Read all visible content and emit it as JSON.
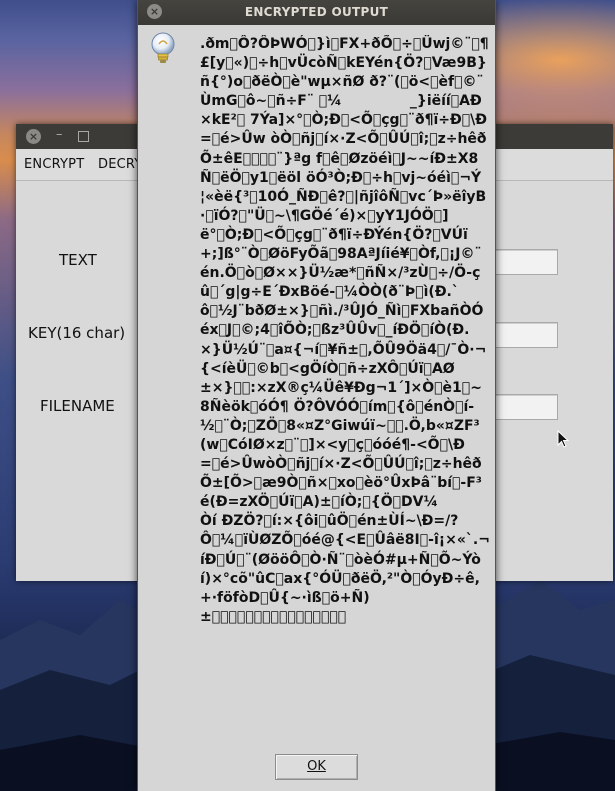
{
  "background_window": {
    "menu": [
      "ENCRYPT",
      "DECRY"
    ],
    "labels": {
      "text": "TEXT",
      "key": "KEY(16 char)",
      "filename": "FILENAME"
    }
  },
  "dialog": {
    "title": "ENCRYPTED OUTPUT",
    "icon": "info-lightbulb-icon",
    "message": ".ðm\u0000Ô?ÔÞWÓ\u0000}ì\u0000FX+ðÕ\u0000÷\u0000Üwj©¨\u0000¶£[y\u0000«)\u0000÷h\u0000vÜcòÑ\u0000kEYén{Ö?\u0000Væ9B}ñ{°)o\u0000ðëÒ\u0000è\"wµ×ñØ ð?¨(\u0000ö<\u0000èf\u0000©¨ÙmG\u0000ô~\u0000ñ÷F¨ \u0000¼              _}iëíí\u0000AÐ×kE²\u0000 7Ýa]×°\u0000Ò;Ð\u0000<Õ\u0000çg\u0000¨ð¶ï÷Ð\u0000\\Ð=\u0000é>Ûw òÒ\u0000ñj\u0000í×·Z<Õ\u0000ÛÚ\u0000î;\u0000z÷hêðÕ±êE\u0000\u0000\u0000\u0000¨}ªg f\u0000ê\u0000Øzöéì\u0000J~~íÐ±X8Ñ\u0000ëÖ\u0000y1\u0000ëöl öÓ³Ò;Ð\u0000÷h\u0000vj~óéì\u0000¬Ý¦«èë{³\u000010Ó_ÑÐ\u0000ê?\u0000|ñjîôÑ\u0000vc´Þ»ëîyB·\u0000ïÓ?\u0000\"Ü\u0000~\\¶GÖé´é)×\u0000yY1JÓÖ\u0000]ë°\u0000Ò;Ð\u0000<Õ\u0000çg\u0000¨ð¶ï÷ÐÝén{Ö?\u0000VÚï+;]ß°¨Ò\u0000ØöFyÕã\u000098AªJíié¥\u0000Òf,\u0000¡J©¨én.Ö\u0000ò\u0000Ø××}Ü½æ*\u0000ñÑ×/³zÙ\u0000÷/Ö-çû\u0000´g|g÷E´ÐxBöé-\u0000¼ÒÒ(ð¨Þ\u0000ì(Ð.`ô\u0000½J¨bðØ±×}\u0000ñì./³ÛJÓ_Ñì\u0000FXbañÒÓéx\u0000J\u0000©;4\u0000îÕÒ;\u0000ßz³ÛÛv\u0000_íÐÖ\u0000íÒ(Ð.×}Ü½Ú¨\u0000a¤{¬í\u0000¥ñ±\u0000,ÕÛ9Öä4\u0000/¯Ò·¬{<íèÜ\u0000©b\u0000<gÖíÒ\u0000ñ÷zXÔ\u0000Úï\u0000AØ±×}\u0000\u0000:×zX®ç¼Üê¥Ðg¬1´]×Ò\u0000è1\u0000~8Ñèök\u0000óÓ¶ Ö?ÔVÓÓ\u0000ím\u0000{ô\u0000énÒ\u0000í-½\u0000¨Ò;\u0000ZÖ\u00008«¤Z°Giwúï~\u0000\u0000.Ö,b«¤ZF³(w\u0000CóIØ×z\u0000¨\u0000]×<y\u0000ç\u0000óóé¶-<Õ\u0000\\Ð=\u0000é>ÛwòÒ\u0000ñj\u0000í×·Z<Õ\u0000ÛÚ\u0000î;\u0000z÷hêðÕ±[Õ>\u0000æ9Ò\u0000ñ×\u0000xo\u0000èö°ÛxÞâ¨bí\u0000-F³é(Ð=zXÖ\u0000Úï\u0000A)±\u0000íÒ;\u0000{Ö\u0000DV¼          Òí ÐZÖ?\u0000í:×{ôi\u0000ûÖ\u0000én±ÙÍ~\\Ð=/?Ô\u0000¼\u0000ïÙØZÕ\u0000óé@{<E\u0000Ûâë8I\u0000-î¡×«`.¬íÐ\u0000Ú\u0000¨(ØööÔ\u0000Ò·Ñ¨\u0000òèÓ#µ+Ñ\u0000Õ~Ýòí)×°cõ\"ûC\u0000ax{°ÓÜ\u0000ðëÖ,²\"Ò\u0000ÓyÐ÷ê,+·föfòD\u0000Û{~·ìß\u0000ö+Ñ)±\u0000\u0000\u0000\u0000\u0000\u0000\u0000\u0000\u0000\u0000\u0000\u0000\u0000\u0000\u0000\u0000",
    "ok_label": "OK"
  }
}
